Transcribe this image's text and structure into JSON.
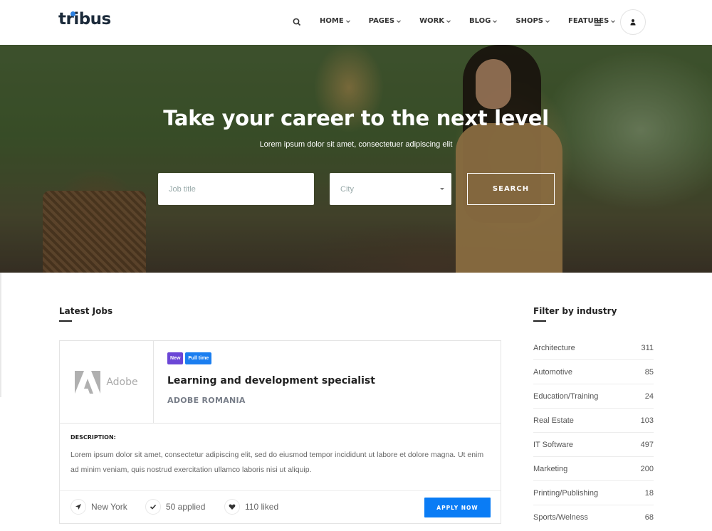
{
  "header": {
    "logo": "tribus",
    "nav": [
      {
        "label": "HOME"
      },
      {
        "label": "PAGES"
      },
      {
        "label": "WORK"
      },
      {
        "label": "BLOG"
      },
      {
        "label": "SHOPS"
      },
      {
        "label": "FEATURES"
      }
    ]
  },
  "hero": {
    "title": "Take your career to the next level",
    "subtitle": "Lorem ipsum dolor sit amet, consectetuer adipiscing elit",
    "job_placeholder": "Job title",
    "city_placeholder": "City",
    "search_label": "SEARCH"
  },
  "jobs": {
    "section_title": "Latest Jobs",
    "items": [
      {
        "logo_text": "Adobe",
        "badges": [
          "New",
          "Full time"
        ],
        "title": "Learning and development specialist",
        "company": "ADOBE ROMANIA",
        "description_label": "DESCRIPTION:",
        "description": "Lorem ipsum dolor sit amet, consectetur adipiscing elit, sed do eiusmod tempor incididunt ut labore et dolore magna. Ut enim ad minim veniam, quis nostrud exercitation ullamco laboris nisi ut aliquip.",
        "location": "New York",
        "applied": "50 applied",
        "liked": "110 liked",
        "apply_label": "APPLY NOW"
      }
    ]
  },
  "filter": {
    "title": "Filter by industry",
    "items": [
      {
        "label": "Architecture",
        "count": "311"
      },
      {
        "label": "Automotive",
        "count": "85"
      },
      {
        "label": "Education/Training",
        "count": "24"
      },
      {
        "label": "Real Estate",
        "count": "103"
      },
      {
        "label": "IT Software",
        "count": "497"
      },
      {
        "label": "Marketing",
        "count": "200"
      },
      {
        "label": "Printing/Publishing",
        "count": "18"
      },
      {
        "label": "Sports/Welness",
        "count": "68"
      }
    ]
  },
  "colors": {
    "accent": "#0a7cf5",
    "badge_new": "#6b46d6",
    "badge_full": "#1a7ef0",
    "logo_dot": "#2a7fe0"
  },
  "icons": [
    "search-icon",
    "chevron-down-icon",
    "menu-icon",
    "user-icon",
    "location-arrow-icon",
    "check-icon",
    "heart-icon"
  ]
}
